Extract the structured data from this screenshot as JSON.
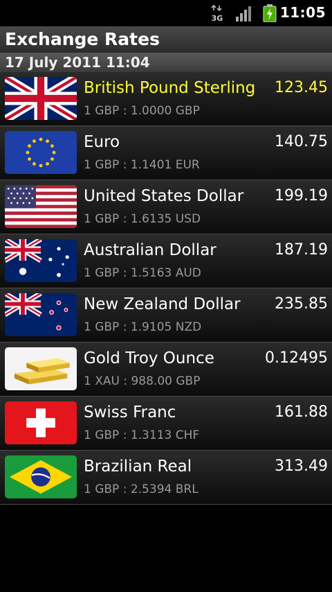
{
  "status_bar": {
    "time": "11:05",
    "network_label": "3G",
    "icons": [
      "3g-data-icon",
      "signal-strength-icon",
      "battery-charging-icon"
    ]
  },
  "header": {
    "title": "Exchange Rates",
    "date": "17 July 2011 11:04"
  },
  "colors": {
    "highlight": "#ffff33",
    "secondary_text": "#9a9a9a"
  },
  "currencies": [
    {
      "name": "British Pound Sterling",
      "value": "123.45",
      "rate": "1 GBP : 1.0000 GBP",
      "icon": "uk-flag-icon"
    },
    {
      "name": "Euro",
      "value": "140.75",
      "rate": "1 GBP : 1.1401 EUR",
      "icon": "eu-flag-icon"
    },
    {
      "name": "United States Dollar",
      "value": "199.19",
      "rate": "1 GBP : 1.6135 USD",
      "icon": "us-flag-icon"
    },
    {
      "name": "Australian Dollar",
      "value": "187.19",
      "rate": "1 GBP : 1.5163 AUD",
      "icon": "australia-flag-icon"
    },
    {
      "name": "New Zealand Dollar",
      "value": "235.85",
      "rate": "1 GBP : 1.9105 NZD",
      "icon": "new-zealand-flag-icon"
    },
    {
      "name": "Gold Troy Ounce",
      "value": "0.12495",
      "rate": "1 XAU : 988.00 GBP",
      "icon": "gold-bars-icon"
    },
    {
      "name": "Swiss Franc",
      "value": "161.88",
      "rate": "1 GBP : 1.3113 CHF",
      "icon": "swiss-flag-icon"
    },
    {
      "name": "Brazilian Real",
      "value": "313.49",
      "rate": "1 GBP : 2.5394 BRL",
      "icon": "brazil-flag-icon"
    }
  ]
}
